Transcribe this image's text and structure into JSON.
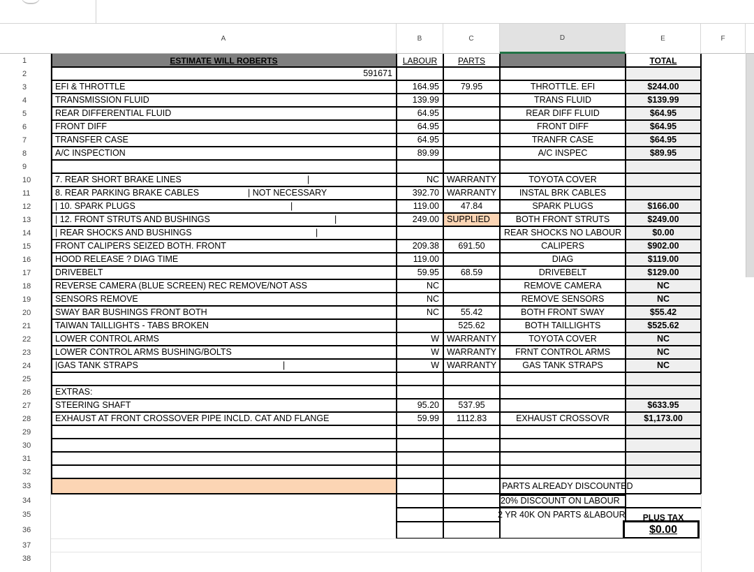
{
  "columns": [
    "A",
    "B",
    "C",
    "D",
    "E",
    "F"
  ],
  "rows": [
    "1",
    "2",
    "3",
    "4",
    "5",
    "6",
    "7",
    "8",
    "9",
    "10",
    "11",
    "12",
    "13",
    "14",
    "15",
    "16",
    "17",
    "18",
    "19",
    "20",
    "21",
    "22",
    "23",
    "24",
    "25",
    "26",
    "27",
    "28",
    "29",
    "30",
    "31",
    "32",
    "33",
    "34",
    "35",
    "36",
    "37",
    "38"
  ],
  "sheet": {
    "title": "ESTIMATE WILL ROBERTS",
    "header_labour": "LABOUR",
    "header_parts": "PARTS",
    "header_total": "TOTAL",
    "ref_number": "591671",
    "items": [
      {
        "row": 3,
        "a": "EFI & THROTTLE",
        "b": "164.95",
        "c": "79.95",
        "d": "THROTTLE. EFI",
        "e": "$244.00"
      },
      {
        "row": 4,
        "a": "TRANSMISSION FLUID",
        "b": "139.99",
        "c": "",
        "d": "TRANS FLUID",
        "e": "$139.99"
      },
      {
        "row": 5,
        "a": "REAR DIFFERENTIAL FLUID",
        "b": "64.95",
        "c": "",
        "d": "REAR DIFF FLUID",
        "e": "$64.95"
      },
      {
        "row": 6,
        "a": "FRONT DIFF",
        "b": "64.95",
        "c": "",
        "d": "FRONT DIFF",
        "e": "$64.95"
      },
      {
        "row": 7,
        "a": "TRANSFER CASE",
        "b": "64.95",
        "c": "",
        "d": "TRANFR CASE",
        "e": "$64.95"
      },
      {
        "row": 8,
        "a": "A/C INSPECTION",
        "b": "89.99",
        "c": "",
        "d": "A/C INSPEC",
        "e": "$89.95"
      },
      {
        "row": 10,
        "a": "7. REAR SHORT BRAKE LINES",
        "b": "NC",
        "c": "WARRANTY",
        "d": "TOYOTA COVER",
        "e": ""
      },
      {
        "row": 11,
        "a": "8. REAR PARKING BRAKE CABLES",
        "b": "392.70",
        "c": "WARRANTY",
        "d": "INSTAL BRK CABLES",
        "e": ""
      },
      {
        "row": 12,
        "a": "| 10. SPARK PLUGS",
        "b": "119.00",
        "c": "47.84",
        "d": "SPARK PLUGS",
        "e": "$166.00"
      },
      {
        "row": 13,
        "a": "| 12. FRONT STRUTS AND BUSHINGS",
        "b": "249.00",
        "c": "SUPPLIED",
        "d": "BOTH FRONT STRUTS",
        "e": "$249.00"
      },
      {
        "row": 14,
        "a": "| REAR SHOCKS AND BUSHINGS",
        "b": "",
        "c": "",
        "d": "REAR SHOCKS NO LABOUR",
        "e": "$0.00"
      },
      {
        "row": 15,
        "a": "FRONT CALIPERS SEIZED BOTH. FRONT",
        "b": "209.38",
        "c": "691.50",
        "d": "CALIPERS",
        "e": "$902.00"
      },
      {
        "row": 16,
        "a": "HOOD RELEASE ?  DIAG TIME",
        "b": "119.00",
        "c": "",
        "d": "DIAG",
        "e": "$119.00"
      },
      {
        "row": 17,
        "a": "DRIVEBELT",
        "b": "59.95",
        "c": "68.59",
        "d": "DRIVEBELT",
        "e": "$129.00"
      },
      {
        "row": 18,
        "a": "REVERSE CAMERA (BLUE SCREEN) REC REMOVE/NOT ASS",
        "b": "NC",
        "c": "",
        "d": "REMOVE CAMERA",
        "e": "NC"
      },
      {
        "row": 19,
        "a": "SENSORS REMOVE",
        "b": "NC",
        "c": "",
        "d": "REMOVE SENSORS",
        "e": "NC"
      },
      {
        "row": 20,
        "a": "SWAY BAR BUSHINGS FRONT BOTH",
        "b": "NC",
        "c": "55.42",
        "d": "BOTH FRONT SWAY",
        "e": "$55.42"
      },
      {
        "row": 21,
        "a": "TAIWAN TAILLIGHTS - TABS BROKEN",
        "b": "",
        "c": "525.62",
        "d": "BOTH TAILLIGHTS",
        "e": "$525.62"
      },
      {
        "row": 22,
        "a": "LOWER CONTROL ARMS",
        "b": "W",
        "c": "WARRANTY",
        "d": "TOYOTA COVER",
        "e": "NC"
      },
      {
        "row": 23,
        "a": "LOWER CONTROL ARMS BUSHING/BOLTS",
        "b": "W",
        "c": "WARRANTY",
        "d": "FRNT CONTROL ARMS",
        "e": "NC"
      },
      {
        "row": 24,
        "a": "|GAS TANK STRAPS",
        "b": "W",
        "c": "WARRANTY",
        "d": "GAS TANK STRAPS",
        "e": "NC"
      },
      {
        "row": 26,
        "a": "EXTRAS:",
        "b": "",
        "c": "",
        "d": "",
        "e": ""
      },
      {
        "row": 27,
        "a": "STEERING SHAFT",
        "b": "95.20",
        "c": "537.95",
        "d": "",
        "e": "$633.95"
      },
      {
        "row": 28,
        "a": "EXHAUST AT FRONT CROSSOVER PIPE INCLD. CAT AND FLANGE",
        "b": "59.99",
        "c": "1112.83",
        "d": "EXHAUST CROSSOVR",
        "e": "$1,173.00"
      }
    ],
    "not_necessary": "| NOT NECESSARY",
    "pipe": "|",
    "note_parts_discounted": "PARTS ALREADY DISCOUNTED",
    "note_discount_labour": "20% DISCOUNT ON LABOUR",
    "note_warranty": "2 YR 40K ON PARTS &LABOUR",
    "plus_tax": "PLUS TAX",
    "grand_total": "$0.00"
  },
  "colors": {
    "title_fill": "#7f7f7f",
    "total_col_fill": "#efefef",
    "peach": "#fcd5b4",
    "selected_col_accent": "#217346"
  }
}
